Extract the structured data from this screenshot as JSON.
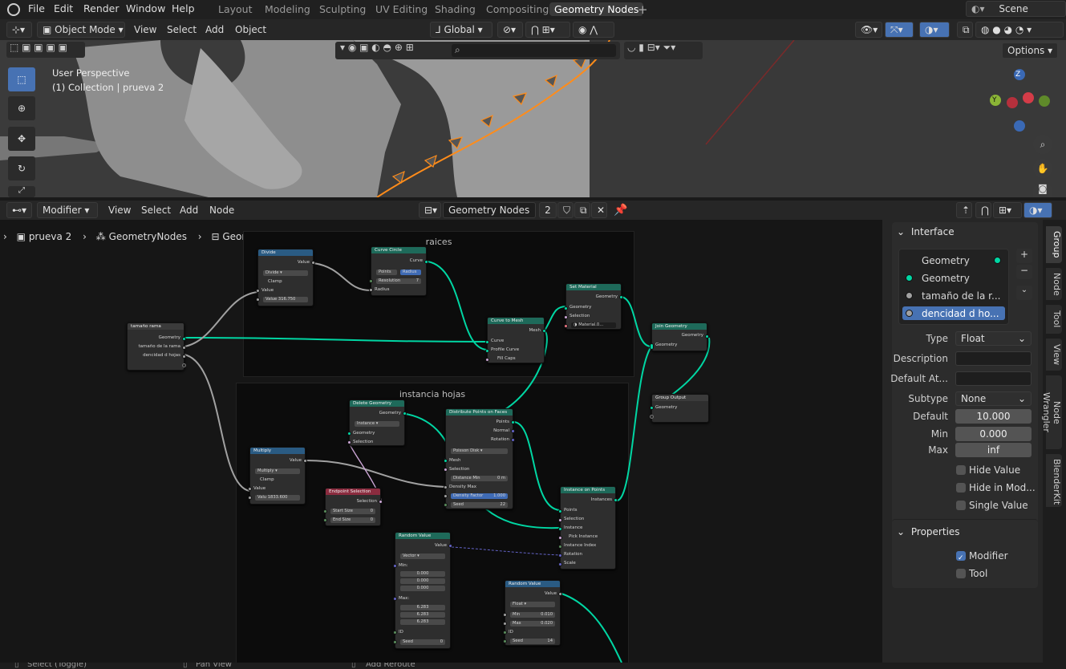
{
  "topbar": {
    "menus": [
      "File",
      "Edit",
      "Render",
      "Window",
      "Help"
    ],
    "workspaces": [
      "Layout",
      "Modeling",
      "Sculpting",
      "UV Editing",
      "Shading",
      "Compositing",
      "Geometry Nodes"
    ],
    "active_workspace": "Geometry Nodes",
    "scene": "Scene"
  },
  "viewport": {
    "mode": "Object Mode",
    "menus": [
      "View",
      "Select",
      "Add",
      "Object"
    ],
    "transform_orientation": "Global",
    "overlay_title": "User Perspective",
    "overlay_collection": "(1) Collection | prueva 2",
    "options_label": "Options",
    "gizmo": {
      "z": "Z",
      "y": "Y"
    }
  },
  "node_editor": {
    "editor_type": "Modifier",
    "menus": [
      "View",
      "Select",
      "Add",
      "Node"
    ],
    "tree_name": "Geometry Nodes",
    "users": "2",
    "breadcrumb": [
      "prueva 2",
      "GeometryNodes",
      "Geometry Nodes"
    ],
    "frames": {
      "raices": "raices",
      "instancia": "instancia hojas"
    },
    "nodes": {
      "group_input": {
        "title": "tamaño rama",
        "out1": "Geometry",
        "out2": "tamaño de la rama",
        "out3": "dencidad d hojas"
      },
      "divide": {
        "title": "Divide",
        "out": "Value",
        "op": "Divide",
        "clamp": "Clamp",
        "in_value": "Value",
        "val_label": "Value",
        "val": "316.750"
      },
      "curve_circle": {
        "title": "Curve Circle",
        "out": "Curve",
        "mode1": "Points",
        "mode2": "Radius",
        "res_label": "Resolution",
        "res": "7",
        "radius": "Radius"
      },
      "curve_to_mesh": {
        "title": "Curve to Mesh",
        "out": "Mesh",
        "in1": "Curve",
        "in2": "Profile Curve",
        "in3": "Fill Caps"
      },
      "set_material": {
        "title": "Set Material",
        "out": "Geometry",
        "in1": "Geometry",
        "in2": "Selection",
        "mat": "Material.0..."
      },
      "join_geometry": {
        "title": "Join Geometry",
        "out": "Geometry",
        "in": "Geometry"
      },
      "group_output": {
        "title": "Group Output",
        "in": "Geometry"
      },
      "delete_geometry": {
        "title": "Delete Geometry",
        "out": "Geometry",
        "mode": "Instance",
        "in1": "Geometry",
        "in2": "Selection"
      },
      "distribute": {
        "title": "Distribute Points on Faces",
        "out1": "Points",
        "out2": "Normal",
        "out3": "Rotation",
        "mode": "Poisson Disk",
        "in1": "Mesh",
        "in2": "Selection",
        "dmin_label": "Distance Min",
        "dmin": "0 m",
        "dmax": "Density Max",
        "dfac_label": "Density Factor",
        "dfac": "1.000",
        "seed_label": "Seed",
        "seed": "22"
      },
      "multiply": {
        "title": "Multiply",
        "out": "Value",
        "op": "Multiply",
        "clamp": "Clamp",
        "in_value": "Value",
        "val_label": "Valu",
        "val": "1833.600"
      },
      "endpoint": {
        "title": "Endpoint Selection",
        "out": "Selection",
        "start_label": "Start Size",
        "start": "0",
        "end_label": "End Size",
        "end": "0"
      },
      "instance_on_points": {
        "title": "Instance on Points",
        "out": "Instances",
        "in1": "Points",
        "in2": "Selection",
        "in3": "Instance",
        "in4": "Pick Instance",
        "in5": "Instance Index",
        "in6": "Rotation",
        "in7": "Scale"
      },
      "random_vec": {
        "title": "Random Value",
        "out": "Value",
        "type": "Vector",
        "min_label": "Min:",
        "min": [
          "0.000",
          "0.000",
          "0.000"
        ],
        "max_label": "Max:",
        "max": [
          "6.283",
          "6.283",
          "6.283"
        ],
        "id": "ID",
        "seed_label": "Seed",
        "seed": "0"
      },
      "random_flt": {
        "title": "Random Value",
        "out": "Value",
        "type": "Float",
        "min_label": "Min",
        "min": "0.010",
        "max_label": "Max",
        "max": "0.020",
        "id": "ID",
        "seed_label": "Seed",
        "seed": "14"
      }
    }
  },
  "sidebar": {
    "interface_title": "Interface",
    "items": [
      "Geometry",
      "Geometry",
      "tamaño de la r...",
      "dencidad d ho..."
    ],
    "type_label": "Type",
    "type_value": "Float",
    "description_label": "Description",
    "default_attr_label": "Default At...",
    "subtype_label": "Subtype",
    "subtype_value": "None",
    "default_label": "Default",
    "default_value": "10.000",
    "min_label": "Min",
    "min_value": "0.000",
    "max_label": "Max",
    "max_value": "inf",
    "hide_value": "Hide Value",
    "hide_in_mod": "Hide in Mod...",
    "single_value": "Single Value",
    "properties_title": "Properties",
    "modifier": "Modifier",
    "tool": "Tool",
    "tabs": [
      "Group",
      "Node",
      "Tool",
      "View",
      "Node Wrangler",
      "BlenderKit"
    ]
  },
  "statusbar": {
    "items": [
      "Select (Toggle)",
      "Pan View",
      "Add Reroute"
    ]
  },
  "colors": {
    "accent": "#4772b3",
    "geometry_socket": "#00d6a3",
    "selection_orange": "#ff8c1a"
  }
}
